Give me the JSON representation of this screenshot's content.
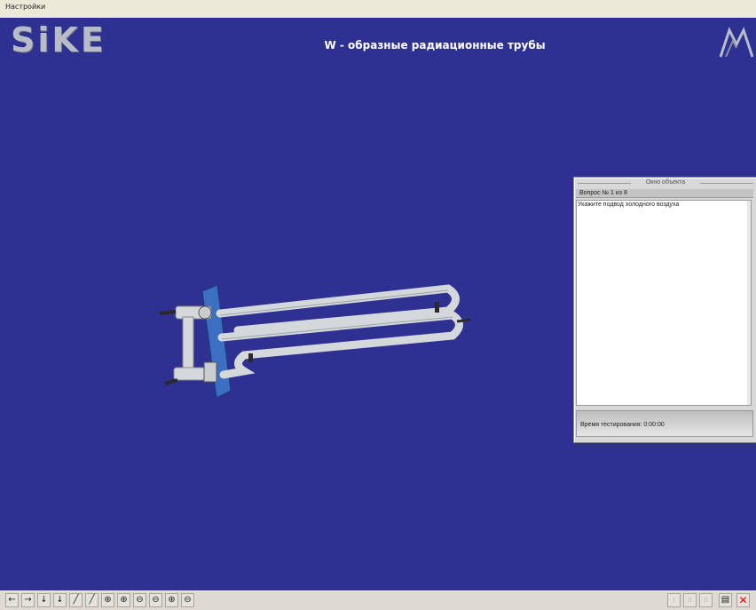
{
  "menu": {
    "settings": "Настройки"
  },
  "header": {
    "logo_text": "SiKE",
    "title": "W - образные радиационные трубы"
  },
  "panel": {
    "title": "Окно объекта",
    "question": "Вопрос №  1 из 8",
    "prompt": "Укажите подвод холодного воздуха",
    "time": "Время тестирования: 0:00:00"
  },
  "toolbar": {
    "left_icons": [
      "arrow-left-icon",
      "arrow-right-icon",
      "arrow-down-icon",
      "arrow-down-icon",
      "rotate-diag-left-icon",
      "rotate-diag-right-icon",
      "rotate-vertical-icon",
      "rotate-vertical-icon",
      "rotate-horizontal-icon",
      "rotate-horizontal-icon",
      "zoom-in-icon",
      "zoom-out-icon"
    ],
    "left_glyphs": [
      "←",
      "→",
      "↓",
      "↓",
      "╱",
      "╱",
      "⊕",
      "⊕",
      "⊖",
      "⊖",
      "⊕",
      "⊖"
    ],
    "right_glyphs": [
      "⁞",
      "⁞⁞",
      "⁞⁞",
      "▤",
      "✕"
    ]
  },
  "colors": {
    "background": "#2e3191",
    "pipe": "#d5d8da",
    "plate": "#3b6fc2"
  }
}
